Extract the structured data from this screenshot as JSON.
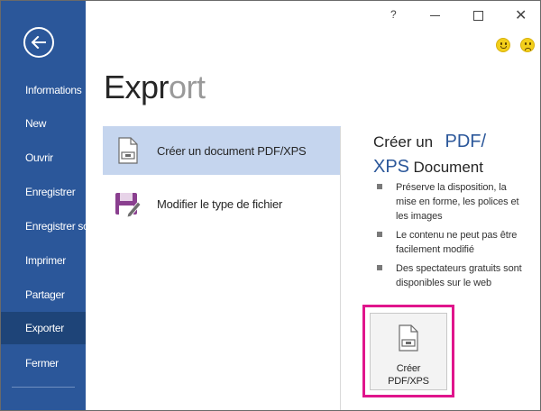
{
  "sidebar": {
    "back_icon": "back-arrow-icon",
    "items": [
      {
        "label": "Informations"
      },
      {
        "label": "New"
      },
      {
        "label": "Ouvrir"
      },
      {
        "label": "Enregistrer"
      },
      {
        "label": "Enregistrer sous"
      },
      {
        "label": "Imprimer"
      },
      {
        "label": "Partager"
      },
      {
        "label": "Exporter",
        "active": true
      },
      {
        "label": "Fermer"
      }
    ],
    "bg_color": "#2b579a",
    "active_color": "#1e4478"
  },
  "titlebar": {
    "help_label": "?",
    "close_label": "✕",
    "feedback": [
      "smile-icon",
      "frown-icon"
    ]
  },
  "page": {
    "title_main": "Expr",
    "title_faded": "ort"
  },
  "options": [
    {
      "label": "Créer un document PDF/XPS",
      "icon": "pdf-document-icon",
      "selected": true
    },
    {
      "label": "Modifier le type de fichier",
      "icon": "change-file-type-icon",
      "selected": false
    }
  ],
  "details": {
    "title_part1": "Créer un",
    "title_part2": "PDF/",
    "title_part3": "XPS",
    "title_part4": "Document",
    "bullets": [
      {
        "text": "Préserve la disposition, la mise en forme, les polices et les images"
      },
      {
        "text": "Le contenu ne peut pas être facilement modifié"
      },
      {
        "text": "Des spectateurs gratuits sont disponibles sur le web"
      }
    ],
    "create_button": {
      "line1": "Créer",
      "line2": "PDF/XPS",
      "icon": "pdf-document-icon"
    },
    "highlight_color": "#e0158c"
  }
}
